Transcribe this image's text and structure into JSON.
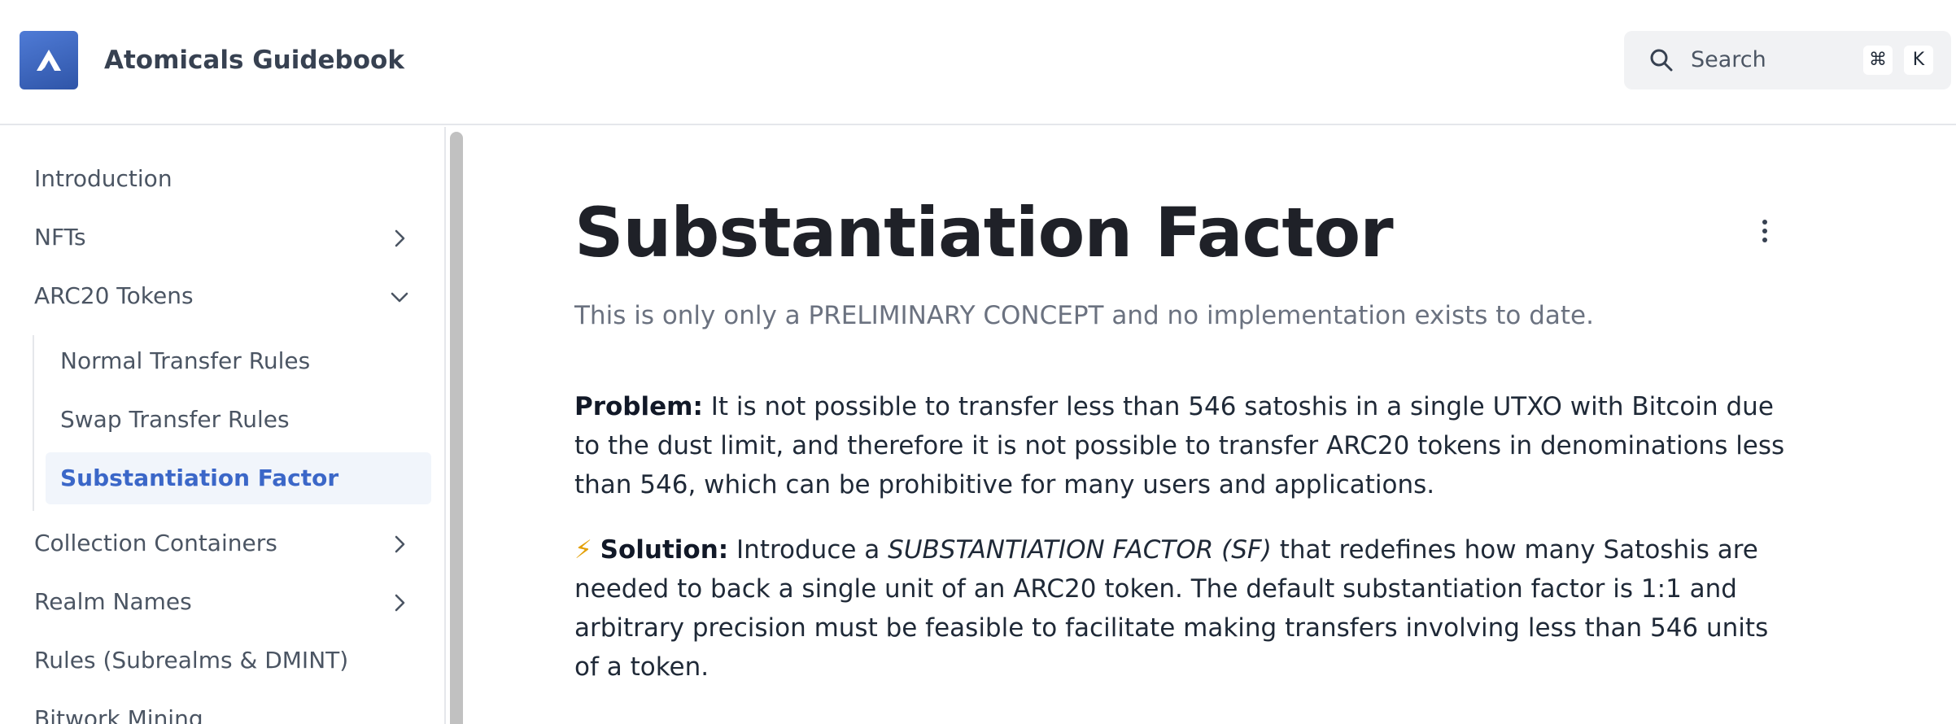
{
  "header": {
    "site_title": "Atomicals Guidebook",
    "search": {
      "label": "Search",
      "shortcut_keys": [
        "⌘",
        "K"
      ]
    }
  },
  "sidebar": {
    "items": [
      {
        "label": "Introduction",
        "chevron": "none"
      },
      {
        "label": "NFTs",
        "chevron": "right"
      },
      {
        "label": "ARC20 Tokens",
        "chevron": "down"
      },
      {
        "label": "Collection Containers",
        "chevron": "right"
      },
      {
        "label": "Realm Names",
        "chevron": "right"
      },
      {
        "label": "Rules (Subrealms & DMINT)",
        "chevron": "none"
      },
      {
        "label": "Bitwork Mining",
        "chevron": "none"
      }
    ],
    "arc20_children": [
      {
        "label": "Normal Transfer Rules"
      },
      {
        "label": "Swap Transfer Rules"
      },
      {
        "label": "Substantiation Factor",
        "active": true
      }
    ]
  },
  "main": {
    "title": "Substantiation Factor",
    "lead": "This is only only a PRELIMINARY CONCEPT and no implementation exists to date.",
    "problem": {
      "label": "Problem:",
      "text": "It is not possible to transfer less than 546 satoshis in a single UTXO with Bitcoin due to the dust limit, and therefore it is not possible to transfer ARC20 tokens in denominations less than 546, which can be prohibitive for many users and applications."
    },
    "solution": {
      "icon": "⚡",
      "label": "Solution:",
      "text_before": "Introduce a",
      "emphasis": "SUBSTANTIATION FACTOR (SF)",
      "text_after": "that redefines how many Satoshis are needed to back a single unit of an ARC20 token. The default substantiation factor is 1:1 and arbitrary precision must be feasible to facilitate making transfers involving less than 546 units of a token."
    }
  },
  "colors": {
    "accent": "#3b67c8",
    "logo": "#3a62bd",
    "active_bg": "#f1f5fb"
  }
}
